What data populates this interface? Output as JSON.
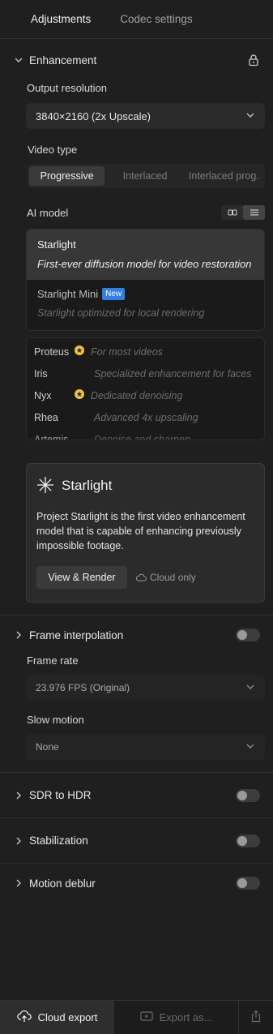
{
  "tabs": [
    {
      "label": "Adjustments",
      "active": true
    },
    {
      "label": "Codec settings",
      "active": false
    }
  ],
  "enhancement": {
    "title": "Enhancement",
    "output_resolution_label": "Output resolution",
    "output_resolution_value": "3840×2160 (2x Upscale)",
    "video_type_label": "Video type",
    "video_types": [
      "Progressive",
      "Interlaced",
      "Interlaced prog."
    ],
    "ai_model_label": "AI model",
    "featured_models": [
      {
        "name": "Starlight",
        "desc": "First-ever diffusion model for video restoration"
      },
      {
        "name": "Starlight Mini",
        "badge": "New",
        "desc": "Starlight optimized for local rendering"
      }
    ],
    "models": [
      {
        "name": "Proteus",
        "star": true,
        "desc": "For most videos"
      },
      {
        "name": "Iris",
        "star": false,
        "desc": "Specialized enhancement for faces"
      },
      {
        "name": "Nyx",
        "star": true,
        "desc": "Dedicated denoising"
      },
      {
        "name": "Rhea",
        "star": false,
        "desc": "Advanced 4x upscaling"
      },
      {
        "name": "Artemis",
        "star": false,
        "desc": "Denoise and sharpen"
      }
    ],
    "promo": {
      "logo_text": "Starlight",
      "body": "Project Starlight is the first video enhancement model that is capable of enhancing previously impossible footage.",
      "button": "View & Render",
      "cloud_note": "Cloud only"
    }
  },
  "frame_interpolation": {
    "title": "Frame interpolation",
    "frame_rate_label": "Frame rate",
    "frame_rate_value": "23.976 FPS (Original)",
    "slow_motion_label": "Slow motion",
    "slow_motion_value": "None"
  },
  "sections": [
    {
      "title": "SDR to HDR"
    },
    {
      "title": "Stabilization"
    },
    {
      "title": "Motion deblur"
    }
  ],
  "footer": {
    "cloud_export": "Cloud export",
    "export_as": "Export as..."
  },
  "colors": {
    "star": "#f1c232",
    "badge": "#2f7fe6"
  }
}
